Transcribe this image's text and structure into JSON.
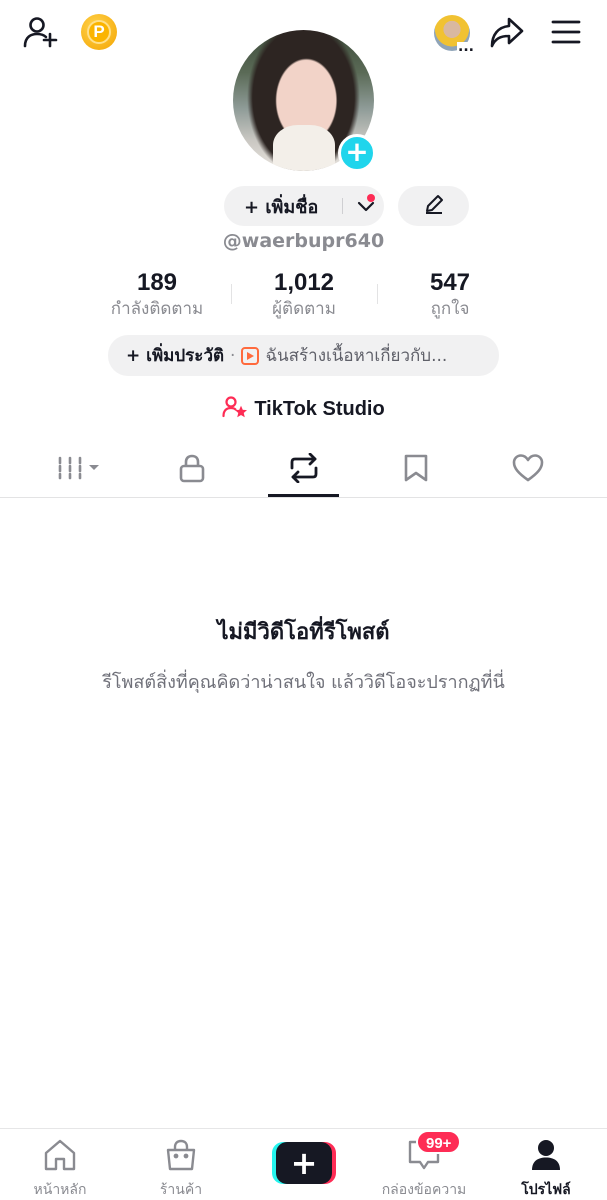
{
  "top_bar": {
    "add_friend_icon": "person-plus-icon",
    "coin_label": "P",
    "share_icon": "share-arrow-icon",
    "menu_icon": "hamburger-icon",
    "mini_avatar_dots": "..."
  },
  "profile": {
    "add_name_label": "+ เพิ่มชื่อ",
    "username": "@waerbupr640",
    "avatar_plus": "+"
  },
  "stats": {
    "following_count": "189",
    "following_label": "กำลังติดตาม",
    "followers_count": "1,012",
    "followers_label": "ผู้ติดตาม",
    "likes_count": "547",
    "likes_label": "ถูกใจ"
  },
  "bio": {
    "add_bio": "+ เพิ่มประวัติ",
    "separator": "·",
    "creator_text": "ฉันสร้างเนื้อหาเกี่ยวกับ..."
  },
  "studio": {
    "label": "TikTok Studio"
  },
  "tabs": [
    {
      "name": "videos",
      "icon": "grid-icon"
    },
    {
      "name": "private",
      "icon": "lock-icon"
    },
    {
      "name": "reposts",
      "icon": "repost-icon",
      "active": true
    },
    {
      "name": "favorites",
      "icon": "bookmark-icon"
    },
    {
      "name": "liked",
      "icon": "heart-icon"
    }
  ],
  "empty_state": {
    "title": "ไม่มีวิดีโอที่รีโพสต์",
    "subtitle": "รีโพสต์สิ่งที่คุณคิดว่าน่าสนใจ แล้ววิดีโอจะปรากฏที่นี่"
  },
  "bottom_nav": {
    "home": "หน้าหลัก",
    "shop": "ร้านค้า",
    "create": "+",
    "inbox": "กล่องข้อความ",
    "inbox_badge": "99+",
    "profile": "โปรไฟล์"
  },
  "colors": {
    "accent_pink": "#fe2c55",
    "accent_cyan": "#25f4ee",
    "avatar_plus": "#20d5ec",
    "text_primary": "#161823",
    "text_secondary": "#8a8b91"
  }
}
